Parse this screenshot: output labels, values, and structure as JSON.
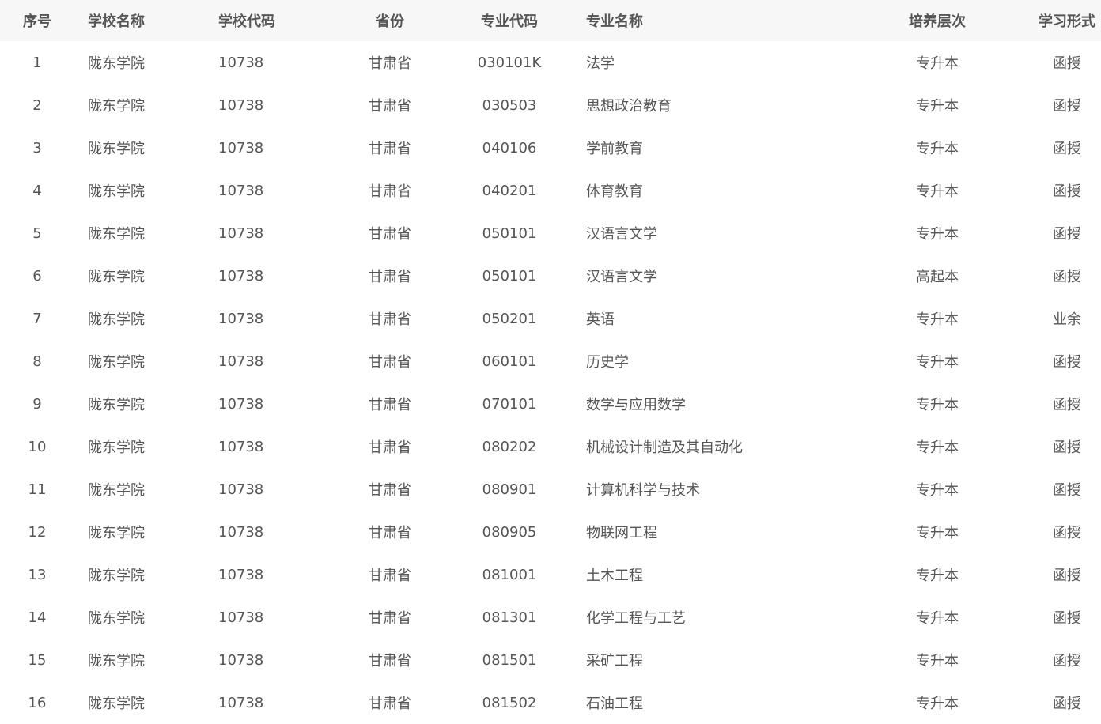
{
  "table": {
    "headers": [
      "序号",
      "学校名称",
      "学校代码",
      "省份",
      "专业代码",
      "专业名称",
      "培养层次",
      "学习形式"
    ],
    "rows": [
      [
        "1",
        "陇东学院",
        "10738",
        "甘肃省",
        "030101K",
        "法学",
        "专升本",
        "函授"
      ],
      [
        "2",
        "陇东学院",
        "10738",
        "甘肃省",
        "030503",
        "思想政治教育",
        "专升本",
        "函授"
      ],
      [
        "3",
        "陇东学院",
        "10738",
        "甘肃省",
        "040106",
        "学前教育",
        "专升本",
        "函授"
      ],
      [
        "4",
        "陇东学院",
        "10738",
        "甘肃省",
        "040201",
        "体育教育",
        "专升本",
        "函授"
      ],
      [
        "5",
        "陇东学院",
        "10738",
        "甘肃省",
        "050101",
        "汉语言文学",
        "专升本",
        "函授"
      ],
      [
        "6",
        "陇东学院",
        "10738",
        "甘肃省",
        "050101",
        "汉语言文学",
        "高起本",
        "函授"
      ],
      [
        "7",
        "陇东学院",
        "10738",
        "甘肃省",
        "050201",
        "英语",
        "专升本",
        "业余"
      ],
      [
        "8",
        "陇东学院",
        "10738",
        "甘肃省",
        "060101",
        "历史学",
        "专升本",
        "函授"
      ],
      [
        "9",
        "陇东学院",
        "10738",
        "甘肃省",
        "070101",
        "数学与应用数学",
        "专升本",
        "函授"
      ],
      [
        "10",
        "陇东学院",
        "10738",
        "甘肃省",
        "080202",
        "机械设计制造及其自动化",
        "专升本",
        "函授"
      ],
      [
        "11",
        "陇东学院",
        "10738",
        "甘肃省",
        "080901",
        "计算机科学与技术",
        "专升本",
        "函授"
      ],
      [
        "12",
        "陇东学院",
        "10738",
        "甘肃省",
        "080905",
        "物联网工程",
        "专升本",
        "函授"
      ],
      [
        "13",
        "陇东学院",
        "10738",
        "甘肃省",
        "081001",
        "土木工程",
        "专升本",
        "函授"
      ],
      [
        "14",
        "陇东学院",
        "10738",
        "甘肃省",
        "081301",
        "化学工程与工艺",
        "专升本",
        "函授"
      ],
      [
        "15",
        "陇东学院",
        "10738",
        "甘肃省",
        "081501",
        "采矿工程",
        "专升本",
        "函授"
      ],
      [
        "16",
        "陇东学院",
        "10738",
        "甘肃省",
        "081502",
        "石油工程",
        "专升本",
        "函授"
      ]
    ]
  },
  "colors": {
    "header_bg": "#f7f7f7",
    "text": "#555555",
    "background": "#ffffff"
  }
}
